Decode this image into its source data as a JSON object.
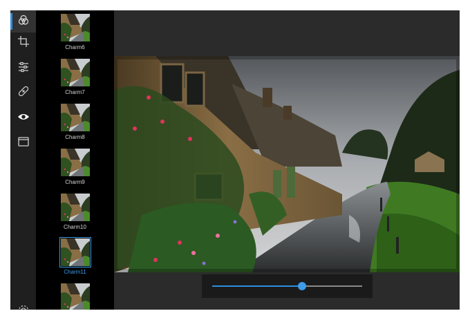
{
  "rail": {
    "items": [
      {
        "icon": "filters-icon",
        "active": true
      },
      {
        "icon": "crop-icon",
        "active": false
      },
      {
        "icon": "adjust-icon",
        "active": false
      },
      {
        "icon": "retouch-icon",
        "active": false
      },
      {
        "icon": "red-eye-icon",
        "active": false
      },
      {
        "icon": "vignette-icon",
        "active": false
      },
      {
        "icon": "settings-icon",
        "active": false
      }
    ]
  },
  "filters": {
    "items": [
      {
        "label": "Charm6",
        "selected": false
      },
      {
        "label": "Charm7",
        "selected": false
      },
      {
        "label": "Charm8",
        "selected": false
      },
      {
        "label": "Charm9",
        "selected": false
      },
      {
        "label": "Charm10",
        "selected": false
      },
      {
        "label": "Charm11",
        "selected": true
      },
      {
        "label": "",
        "selected": false
      }
    ]
  },
  "slider": {
    "value": 0.6
  },
  "colors": {
    "accent": "#2e8ee0",
    "rail_bg": "#1f1f1f",
    "strip_bg": "#000000",
    "canvas_bg": "#2b2b2b"
  }
}
